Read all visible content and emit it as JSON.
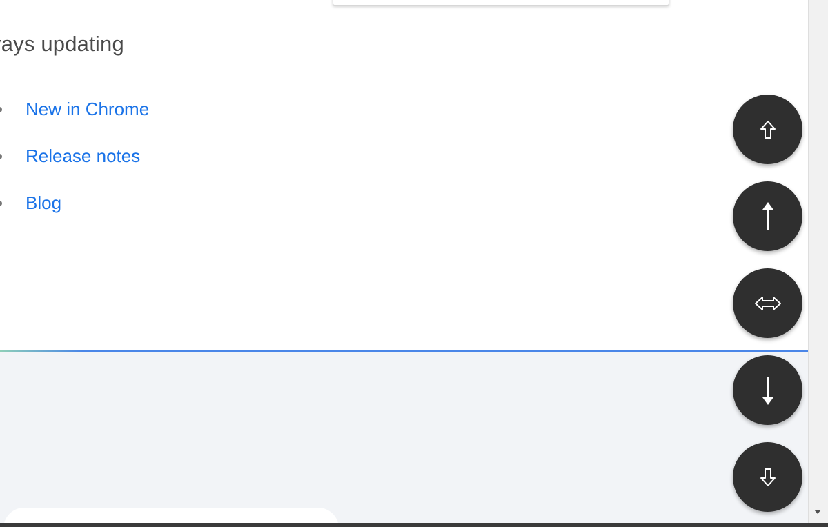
{
  "page": {
    "heading": "vays updating"
  },
  "links": [
    {
      "label": "New in Chrome"
    },
    {
      "label": "Release notes"
    },
    {
      "label": "Blog"
    }
  ],
  "scroll_controls": [
    {
      "name": "scroll-to-top-button",
      "icon": "double-arrow-up-outline-icon"
    },
    {
      "name": "scroll-up-button",
      "icon": "arrow-up-icon"
    },
    {
      "name": "scroll-horizontal-button",
      "icon": "left-right-outline-arrow-icon"
    },
    {
      "name": "scroll-down-button",
      "icon": "arrow-down-icon"
    },
    {
      "name": "scroll-to-bottom-button",
      "icon": "double-arrow-down-outline-icon"
    }
  ],
  "colors": {
    "link": "#1a73e8",
    "heading": "#4a4a4a",
    "divider": "#4a86e8",
    "lower_panel": "#f2f4f7",
    "fab": "#2f2f2f",
    "fab_icon": "#ffffff"
  }
}
